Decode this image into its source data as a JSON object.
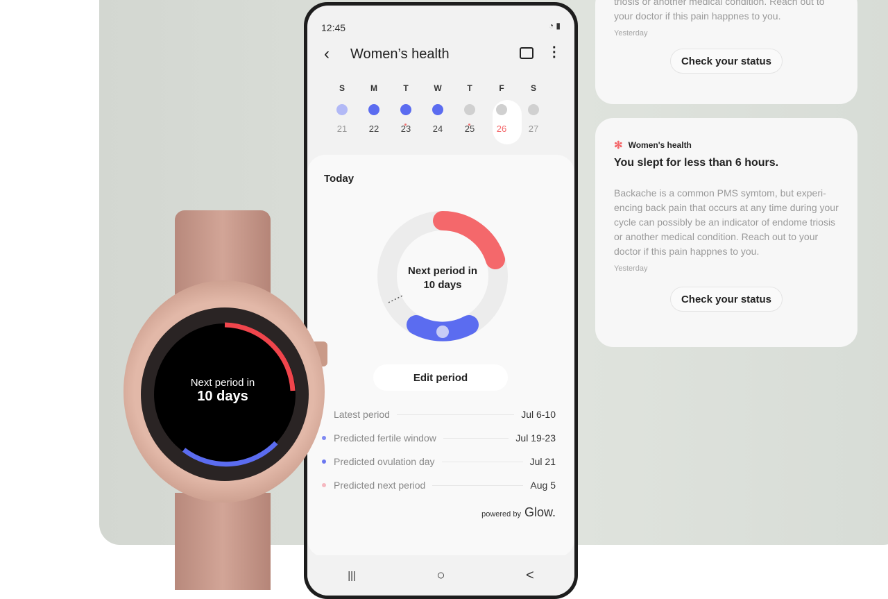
{
  "colors": {
    "accent_blue": "#5b6cf0",
    "accent_red": "#f4686b",
    "panel": "#d8dcd6"
  },
  "cards": [
    {
      "body": "triosis or another medical condition. Reach out to your doctor if this pain happnes to you.",
      "time": "Yesterday",
      "button": "Check your status"
    },
    {
      "app": "Women's health",
      "title": "You slept for less than 6 hours.",
      "body": "Backache is a common PMS symtom, but experi-encing back pain that occurs at any time during your cycle can possibly be an indicator of endome triosis or another medical condition. Reach out to your doctor if this pain happnes to you.",
      "time": "Yesterday",
      "button": "Check your status"
    }
  ],
  "phone": {
    "status_time": "12:45",
    "title": "Women’s health",
    "icons": [
      "back-icon",
      "calendar-icon",
      "more-icon"
    ],
    "week": [
      {
        "label": "S",
        "date": "21",
        "state": "light-blue"
      },
      {
        "label": "M",
        "date": "22",
        "state": "blue"
      },
      {
        "label": "T",
        "date": "23",
        "state": "blue"
      },
      {
        "label": "W",
        "date": "24",
        "state": "blue"
      },
      {
        "label": "T",
        "date": "25",
        "state": "gray"
      },
      {
        "label": "F",
        "date": "26",
        "state": "gray",
        "selected": true
      },
      {
        "label": "S",
        "date": "27",
        "state": "gray"
      }
    ],
    "today_label": "Today",
    "ring_line1": "Next period in",
    "ring_line2": "10 days",
    "edit_button": "Edit period",
    "rows": [
      {
        "label": "Latest period",
        "value": "Jul 6-10"
      },
      {
        "label": "Predicted fertile window",
        "value": "Jul 19-23"
      },
      {
        "label": "Predicted ovulation day",
        "value": "Jul 21"
      },
      {
        "label": "Predicted next period",
        "value": "Aug 5"
      }
    ],
    "powered_by": "powered by",
    "brand": "Glow.",
    "nav": [
      "|||",
      "○",
      "<"
    ]
  },
  "watch": {
    "line1": "Next period in",
    "line2": "10 days"
  }
}
